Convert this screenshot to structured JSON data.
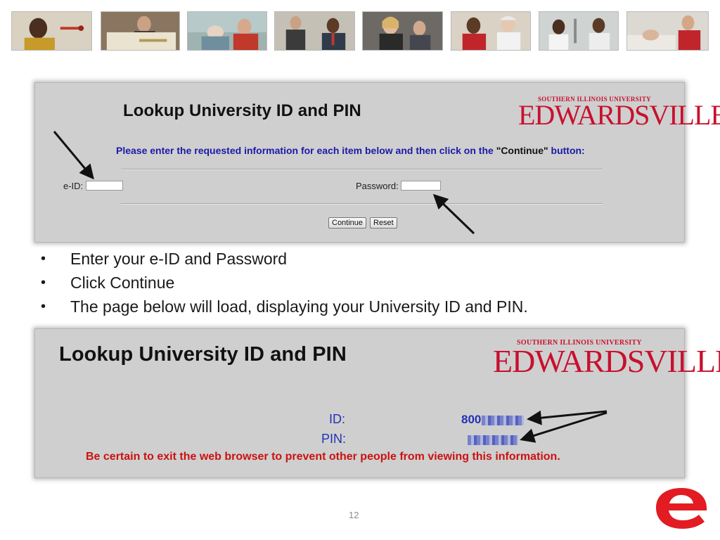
{
  "photo_strip": {
    "photos": [
      {
        "icon": "student-with-pipette-photo-icon"
      },
      {
        "icon": "student-reading-newspaper-photo-icon"
      },
      {
        "icon": "dental-clinic-photo-icon"
      },
      {
        "icon": "business-people-photo-icon"
      },
      {
        "icon": "meeting-photo-icon"
      },
      {
        "icon": "nurses-photo-icon"
      },
      {
        "icon": "lab-researchers-photo-icon"
      },
      {
        "icon": "nursing-simulation-photo-icon"
      }
    ]
  },
  "lookup_form": {
    "title": "Lookup University ID and PIN",
    "logo_small": "SOUTHERN ILLINOIS UNIVERSITY",
    "logo_big": "EDWARDSVILLE",
    "instruction_prefix": "Please enter the requested information for each item below and then click on the",
    "instruction_button_ref": "\"Continue\"",
    "instruction_suffix": "button:",
    "eid_label": "e-ID:",
    "password_label": "Password:",
    "eid_value": "",
    "password_value": "",
    "continue_label": "Continue",
    "reset_label": "Reset"
  },
  "bullets": [
    "Enter your e-ID and Password",
    "Click Continue",
    "The page below will load, displaying your University ID and PIN."
  ],
  "bullet_glyph": "•",
  "result_page": {
    "title": "Lookup University ID and PIN",
    "logo_small": "SOUTHERN ILLINOIS UNIVERSITY",
    "logo_big": "EDWARDSVILLE",
    "id_label": "ID:",
    "pin_label": "PIN:",
    "id_visible_prefix": "800",
    "warning": "Be certain to exit the web browser to prevent other people from viewing this information."
  },
  "page_number": "12",
  "brand_logo": {
    "letter": "e",
    "color": "#e31b23"
  },
  "colors": {
    "brand_red": "#c8102e",
    "link_blue": "#2332b5",
    "warning_red": "#cc1111"
  }
}
